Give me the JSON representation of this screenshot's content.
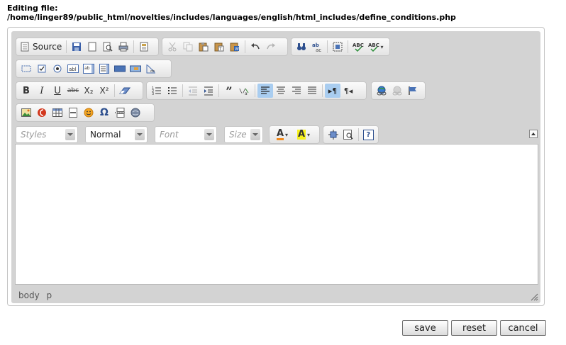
{
  "header": {
    "line1": "Editing file:",
    "line2": "/home/linger89/public_html/novelties/includes/languages/english/html_includes/define_conditions.php"
  },
  "toolbar": {
    "source_label": "Source",
    "styles_placeholder": "Styles",
    "format_value": "Normal",
    "font_placeholder": "Font",
    "size_placeholder": "Size",
    "bold": "B",
    "italic": "I",
    "underline": "U",
    "strike": "abc",
    "subscript": "X₂",
    "superscript": "X²",
    "font_color_letter": "A",
    "bg_color_letter": "A",
    "help": "?"
  },
  "statusbar": {
    "path": [
      "body",
      "p"
    ]
  },
  "buttons": {
    "save": "save",
    "reset": "reset",
    "cancel": "cancel"
  }
}
